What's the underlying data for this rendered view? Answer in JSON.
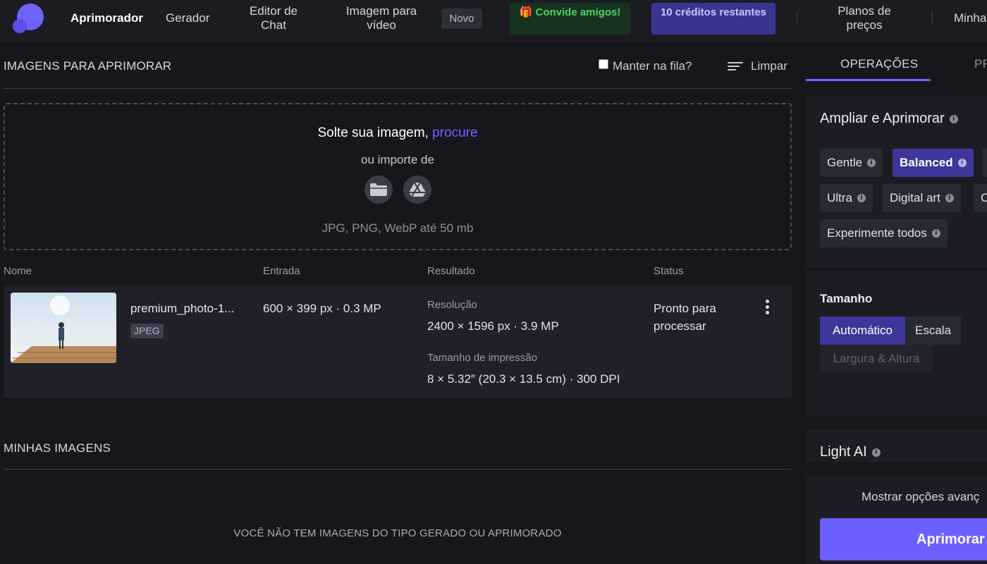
{
  "header": {
    "nav": {
      "enhancer": "Aprimorador",
      "generator": "Gerador",
      "chat_editor": "Editor de Chat",
      "image_to_video": "Imagem para vídeo",
      "new_badge": "Novo",
      "invite": "🎁 Convide amigos!",
      "credits": "10 créditos restantes",
      "pricing": "Planos de preços",
      "my": "Minha"
    }
  },
  "queue": {
    "title": "IMAGENS PARA APRIMORAR",
    "keep_label": "Manter na fila?",
    "keep_checked": false,
    "clear_label": "Limpar"
  },
  "dropzone": {
    "line1": "Solte sua imagem, ",
    "browse_link": "procure",
    "line2": "ou importe de",
    "formats": "JPG, PNG, WebP até 50 mb",
    "sources": [
      "folder-icon",
      "google-drive-icon"
    ]
  },
  "table": {
    "columns": [
      "Nome",
      "Entrada",
      "Resultado",
      "Status"
    ],
    "rows": [
      {
        "name": "premium_photo-1...",
        "type": "JPEG",
        "input": "600 × 399 px · 0.3 MP",
        "resolution_label": "Resolução",
        "resolution": "2400 × 1596 px · 3.9 MP",
        "print_label": "Tamanho de impressão",
        "print": "8 × 5.32″ (20.3 × 13.5 cm) · 300 DPI",
        "status": "Pronto para processar"
      }
    ]
  },
  "my_images": {
    "title": "MINHAS IMAGENS",
    "empty": "VOCÊ NÃO TEM IMAGENS DO TIPO GERADO OU APRIMORADO"
  },
  "sidebar": {
    "tabs": [
      "OPERAÇÕES",
      "PR"
    ],
    "active_tab": 0,
    "upscale": {
      "title": "Ampliar e Aprimorar",
      "modes": [
        "Gentle",
        "Balanced",
        "Ultra",
        "Digital art",
        "Experimente todos"
      ],
      "selected": "Balanced"
    },
    "size": {
      "title": "Tamanho",
      "options": [
        "Automático",
        "Escala"
      ],
      "selected": "Automático",
      "disabled_option": "Largura & Altura"
    },
    "light_ai": {
      "title": "Light AI"
    },
    "advanced": "Mostrar opções avanç",
    "submit": "Aprimorar"
  },
  "colors": {
    "accent": "#6a60ff",
    "selected_chip": "#3d3799",
    "background": "#16171d",
    "panel": "#1c1d24"
  }
}
